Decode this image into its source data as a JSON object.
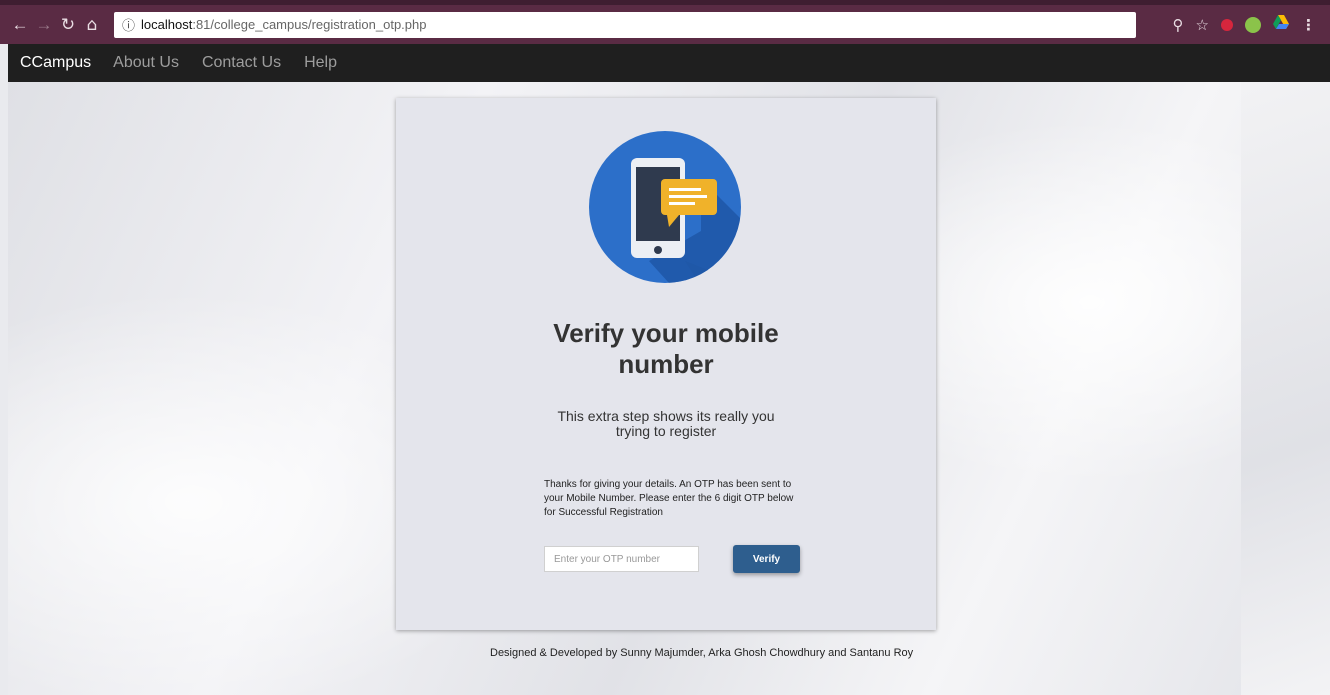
{
  "browser": {
    "url_host": "localhost",
    "url_path": ":81/college_campus/registration_otp.php",
    "info_icon": "info-icon",
    "back_icon": "back-arrow-icon",
    "forward_icon": "forward-arrow-icon",
    "reload_icon": "reload-icon",
    "home_icon": "home-icon",
    "zoom_icon": "zoom-icon",
    "star_icon": "star-icon",
    "menu_icon": "kebab-menu-icon"
  },
  "navbar": {
    "brand": "CCampus",
    "links": [
      "About Us",
      "Contact Us",
      "Help"
    ]
  },
  "card": {
    "icon": "mobile-message-icon",
    "title_line1": "Verify your mobile",
    "title_line2": "number",
    "subtitle_line1": "This extra step shows its really you",
    "subtitle_line2": "trying to register",
    "description": "Thanks for giving your details. An OTP has been sent to your Mobile Number. Please enter the 6 digit OTP below for Successful Registration",
    "otp_placeholder": "Enter your OTP number",
    "verify_label": "Verify"
  },
  "footer": {
    "credits": "Designed & Developed by Sunny Majumder, Arka Ghosh Chowdhury and Santanu Roy"
  },
  "colors": {
    "chrome": "#5a2b44",
    "navbar": "#1f1f1f",
    "button": "#2e5e8e",
    "icon_circle": "#2c6fc9",
    "bubble": "#f0b22a"
  }
}
